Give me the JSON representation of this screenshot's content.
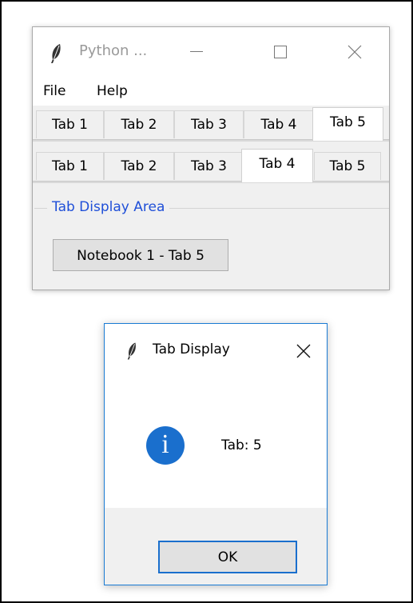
{
  "main_window": {
    "title": "Python ...",
    "menu": [
      "File",
      "Help"
    ],
    "notebook1": {
      "tabs": [
        "Tab 1",
        "Tab 2",
        "Tab 3",
        "Tab 4",
        "Tab 5"
      ],
      "selected": "Tab 5"
    },
    "notebook2": {
      "tabs": [
        "Tab 1",
        "Tab 2",
        "Tab 3",
        "Tab 4",
        "Tab 5"
      ],
      "selected": "Tab 4"
    },
    "group_title": "Tab Display Area",
    "display_button": "Notebook 1 - Tab 5"
  },
  "dialog": {
    "title": "Tab Display",
    "message": "Tab: 5",
    "ok_label": "OK",
    "icon": "info-icon"
  },
  "colors": {
    "group_title": "#1f4fd8",
    "info_icon": "#1a6fcd",
    "dialog_border": "#1a7bd4"
  }
}
